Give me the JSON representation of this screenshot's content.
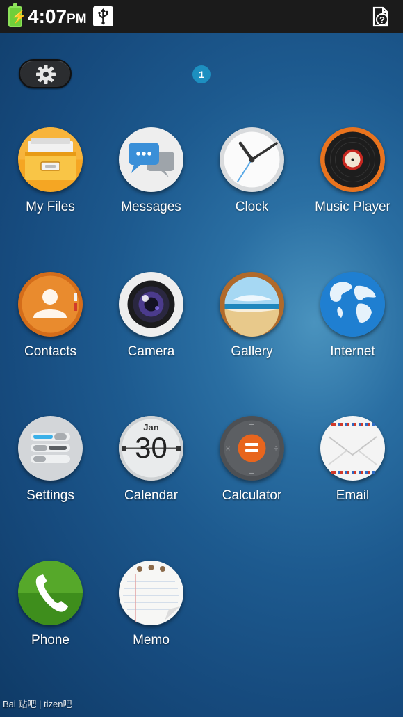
{
  "status_bar": {
    "time": "4:07",
    "ampm": "PM",
    "battery_icon": "battery-charging-icon",
    "usb_icon": "usb-icon",
    "right_icon": "help-icon"
  },
  "home": {
    "settings_button_icon": "gear-icon",
    "page_indicator": "1"
  },
  "apps": [
    {
      "label": "My Files",
      "icon": "my-files-icon"
    },
    {
      "label": "Messages",
      "icon": "messages-icon"
    },
    {
      "label": "Clock",
      "icon": "clock-icon"
    },
    {
      "label": "Music Player",
      "icon": "music-player-icon"
    },
    {
      "label": "Contacts",
      "icon": "contacts-icon"
    },
    {
      "label": "Camera",
      "icon": "camera-icon"
    },
    {
      "label": "Gallery",
      "icon": "gallery-icon"
    },
    {
      "label": "Internet",
      "icon": "internet-icon"
    },
    {
      "label": "Settings",
      "icon": "settings-icon"
    },
    {
      "label": "Calendar",
      "icon": "calendar-icon",
      "month": "Jan",
      "day": "30"
    },
    {
      "label": "Calculator",
      "icon": "calculator-icon"
    },
    {
      "label": "Email",
      "icon": "email-icon"
    },
    {
      "label": "Phone",
      "icon": "phone-icon"
    },
    {
      "label": "Memo",
      "icon": "memo-icon"
    }
  ],
  "watermark": "Bai 贴吧 | tizen吧"
}
